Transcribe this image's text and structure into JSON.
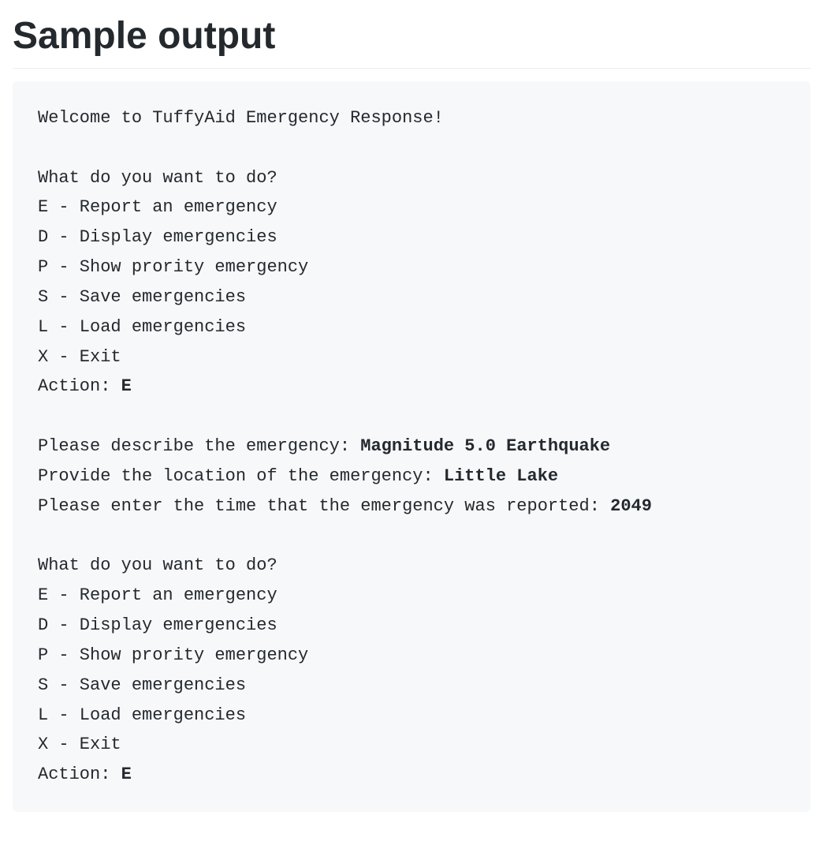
{
  "title": "Sample output",
  "code": {
    "welcome": "Welcome to TuffyAid Emergency Response!",
    "menu_header": "What do you want to do?",
    "opt_e": "E - Report an emergency",
    "opt_d": "D - Display emergencies",
    "opt_p": "P - Show prority emergency",
    "opt_s": "S - Save emergencies",
    "opt_l": "L - Load emergencies",
    "opt_x": "X - Exit",
    "action_label": "Action: ",
    "action1": "E",
    "prompt_describe": "Please describe the emergency: ",
    "input_describe": "Magnitude 5.0 Earthquake",
    "prompt_location": "Provide the location of the emergency: ",
    "input_location": "Little Lake",
    "prompt_time": "Please enter the time that the emergency was reported: ",
    "input_time": "2049",
    "action2": "E"
  }
}
